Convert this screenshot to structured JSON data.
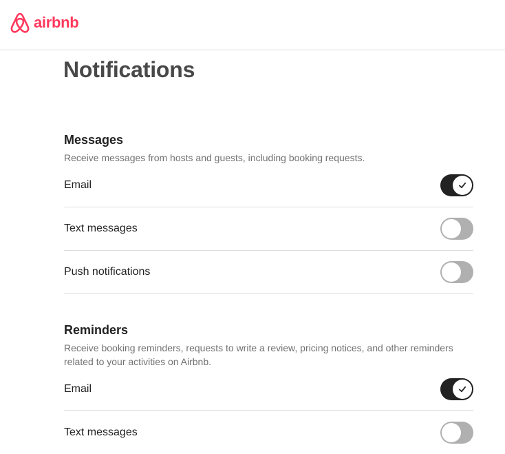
{
  "brand": {
    "name": "airbnb",
    "logo_icon": "airbnb-belo-icon",
    "color": "#ff385c"
  },
  "page": {
    "title": "Notifications"
  },
  "sections": [
    {
      "title": "Messages",
      "description": "Receive messages from hosts and guests, including booking requests.",
      "items": [
        {
          "label": "Email",
          "on": true
        },
        {
          "label": "Text messages",
          "on": false
        },
        {
          "label": "Push notifications",
          "on": false
        }
      ]
    },
    {
      "title": "Reminders",
      "description": "Receive booking reminders, requests to write a review, pricing notices, and other reminders related to your activities on Airbnb.",
      "items": [
        {
          "label": "Email",
          "on": true
        },
        {
          "label": "Text messages",
          "on": false
        }
      ]
    }
  ],
  "colors": {
    "toggle_on": "#222222",
    "toggle_off": "#b0b0b0",
    "divider": "#dddddd"
  }
}
